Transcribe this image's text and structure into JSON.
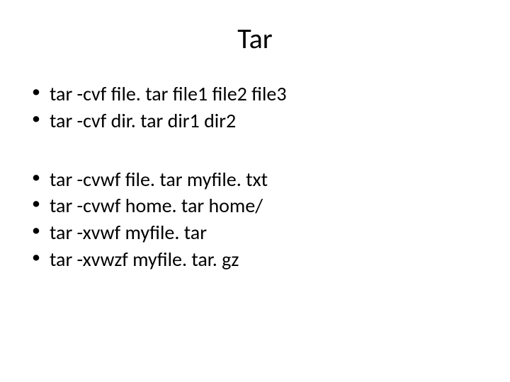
{
  "title": "Tar",
  "group1": {
    "item0": "tar -cvf file. tar file1 file2 file3",
    "item1": "tar -cvf dir. tar dir1 dir2"
  },
  "group2": {
    "item0": "tar -cvwf file. tar myfile. txt",
    "item1": "tar -cvwf home. tar home/",
    "item2": "tar -xvwf myfile. tar",
    "item3": "tar -xvwzf myfile. tar. gz"
  }
}
